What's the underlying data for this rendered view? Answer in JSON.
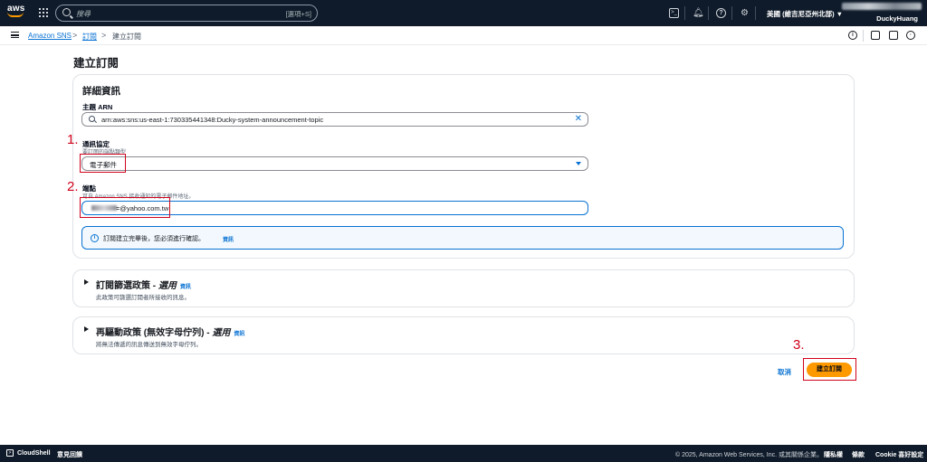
{
  "topnav": {
    "logo": "aws",
    "search_placeholder": "搜尋",
    "search_shortcut": "[選項+S]",
    "icons": [
      "services-grid-icon",
      "cloudshell-icon",
      "bell-icon",
      "help-icon",
      "gear-icon"
    ],
    "region": "美國 (維吉尼亞州北部) ▼",
    "account": "DuckyHuang"
  },
  "breadcrumb": {
    "items": [
      "Amazon SNS",
      "訂閱",
      "建立訂閱"
    ]
  },
  "page": {
    "title": "建立訂閱"
  },
  "details": {
    "title": "詳細資訊",
    "topic_arn_label": "主題 ARN",
    "topic_arn_value": "arn:aws:sns:us-east-1:730335441348:Ducky-system-announcement-topic",
    "protocol_label": "通訊協定",
    "protocol_desc": "要訂閱的端點類型",
    "protocol_value": "電子郵件",
    "endpoint_label": "端點",
    "endpoint_desc": "可自 Amazon SNS 接收通知的電子郵件地址。",
    "endpoint_value": "=@yahoo.com.tw",
    "alert_text": "訂閱建立完畢後，您必須進行確認。",
    "alert_link": "資訊"
  },
  "filter_policy": {
    "title": "訂閱篩選政策 - ",
    "title_em": "選用",
    "info": "資訊",
    "desc": "此政策可篩選訂閱者所接收的訊息。"
  },
  "redrive_policy": {
    "title": "再驅動政策 (無效字母佇列) - ",
    "title_em": "選用",
    "info": "資訊",
    "desc": "將無法傳遞的訊息傳送到無效字母佇列。"
  },
  "annotations": [
    "1.",
    "2.",
    "3."
  ],
  "actions": {
    "cancel": "取消",
    "create": "建立訂閱"
  },
  "footer": {
    "cloudshell": "CloudShell",
    "feedback": "意見回饋",
    "copyright": "© 2025, Amazon Web Services, Inc. 或其關係企業。",
    "privacy": "隱私權",
    "terms": "條款",
    "cookie": "Cookie 喜好設定"
  },
  "colors": {
    "nav_bg": "#0f1b2a",
    "link": "#0972d3",
    "primary_button": "#ff9900",
    "annotation_red": "#d0021b"
  }
}
